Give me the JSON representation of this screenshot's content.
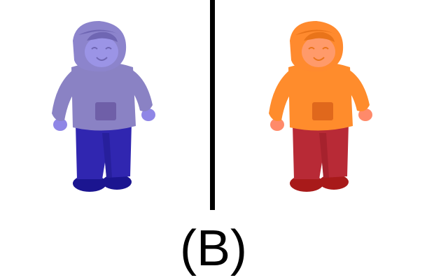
{
  "caption": "(B)",
  "figures": [
    {
      "id": "left",
      "hood": "#8c84cc",
      "hood_dark": "#6f66b3",
      "face": "#9b94e6",
      "body": "#8a82c4",
      "pocket": "#6f5fa8",
      "hands": "#8f86e6",
      "pants": "#3026b0",
      "pants_dark": "#221a8f",
      "shoes": "#1b1590"
    },
    {
      "id": "right",
      "hood": "#ff8a2e",
      "hood_dark": "#e9741a",
      "face": "#ff9a6a",
      "body": "#ff8c2c",
      "pocket": "#e0681c",
      "hands": "#ff8a6a",
      "pants": "#b82a36",
      "pants_dark": "#9a1e28",
      "shoes": "#a81a1a"
    }
  ]
}
